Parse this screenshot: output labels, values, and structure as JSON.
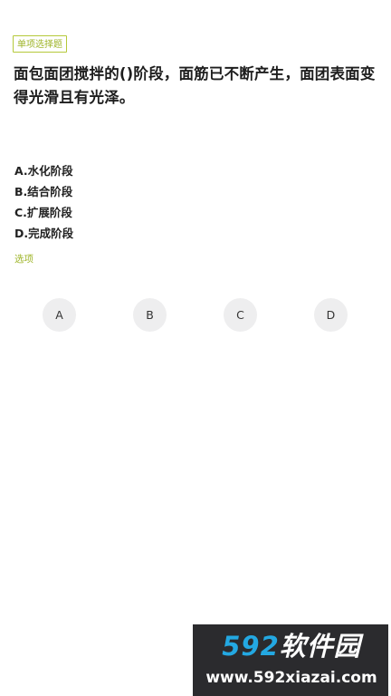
{
  "question": {
    "type_tag": "单项选择题",
    "text": "面包面团搅拌的()阶段，面筋已不断产生，面团表面变得光滑且有光泽。"
  },
  "options": [
    {
      "label": "A.水化阶段"
    },
    {
      "label": "B.结合阶段"
    },
    {
      "label": "C.扩展阶段"
    },
    {
      "label": "D.完成阶段"
    }
  ],
  "hint": "选项",
  "choices": [
    "A",
    "B",
    "C",
    "D"
  ],
  "watermark": {
    "brand_number": "592",
    "brand_text": "软件园",
    "url": "www.592xiazai.com"
  },
  "colors": {
    "accent": "#9fb52a",
    "choice_bg": "#eeeeef",
    "watermark_bg": "#2b2b2e",
    "watermark_blue": "#23a8e2"
  }
}
